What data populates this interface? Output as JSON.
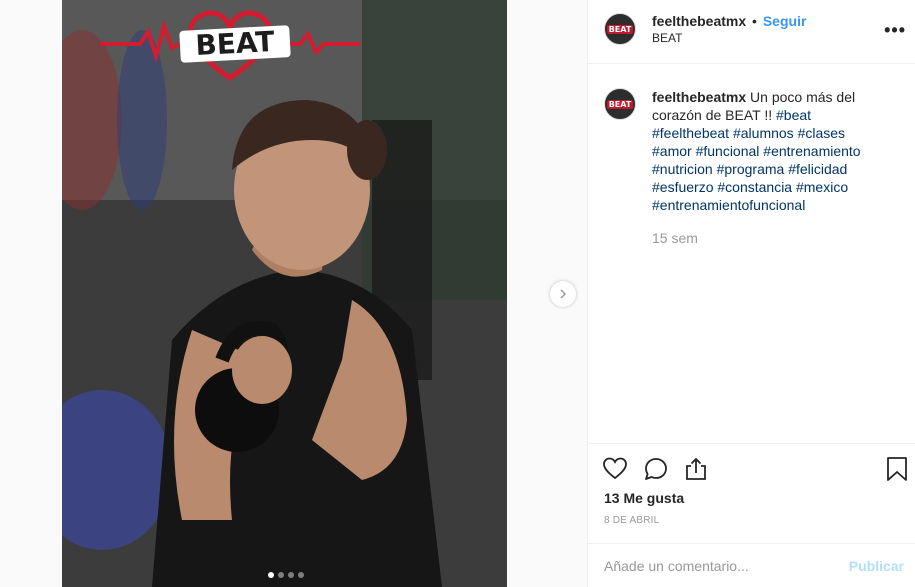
{
  "post": {
    "photo": {
      "logo_text": "BEAT",
      "carousel_dots": 4,
      "active_dot": 0,
      "next_icon": "chevron-right-icon"
    },
    "author": {
      "username": "feelthebeatmx",
      "follow_label": "Seguir",
      "location": "BEAT",
      "avatar_text": "BEAT"
    },
    "more_icon": "more-options-icon",
    "caption": {
      "username": "feelthebeatmx",
      "text": "Un poco más del corazón de BEAT !!",
      "hashtags": [
        "#beat",
        "#feelthebeat",
        "#alumnos",
        "#clases",
        "#amor",
        "#funcional",
        "#entrenamiento",
        "#nutricion",
        "#programa",
        "#felicidad",
        "#esfuerzo",
        "#constancia",
        "#mexico",
        "#entrenamientofuncional"
      ],
      "time_ago": "15 sem"
    },
    "actions": {
      "like_icon": "heart-icon",
      "comment_icon": "comment-icon",
      "share_icon": "share-icon",
      "save_icon": "bookmark-icon"
    },
    "likes_label": "13 Me gusta",
    "date_label": "8 DE ABRIL",
    "comment": {
      "placeholder": "Añade un comentario...",
      "publish_label": "Publicar"
    },
    "colors": {
      "link": "#3897f0",
      "hashtag": "#003569",
      "brand_red": "#c0182c"
    }
  }
}
